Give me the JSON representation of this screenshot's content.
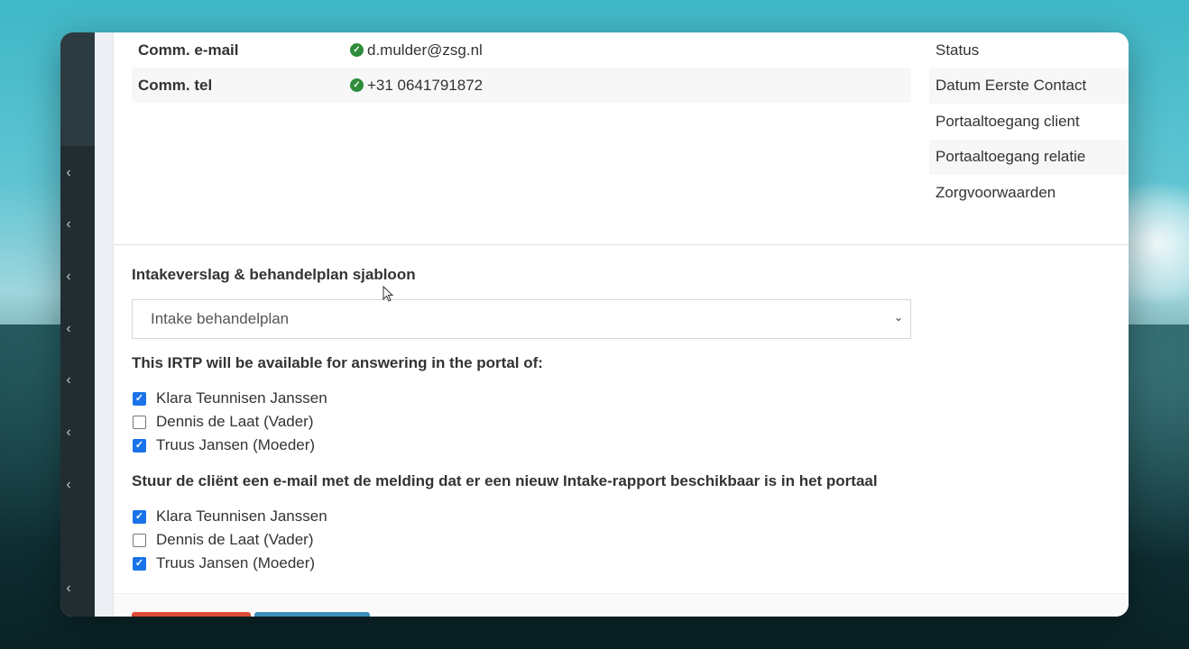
{
  "contact_rows": [
    {
      "label": "Comm. e-mail",
      "value": "d.mulder@zsg.nl"
    },
    {
      "label": "Comm. tel",
      "value": "+31 0641791872"
    }
  ],
  "side_list": [
    "Status",
    "Datum Eerste Contact",
    "Portaaltoegang client",
    "Portaaltoegang relatie",
    "Zorgvoorwaarden"
  ],
  "template": {
    "title": "Intakeverslag & behandelplan sjabloon",
    "selected": "Intake behandelplan"
  },
  "portal": {
    "title": "This IRTP will be available for answering in the portal of:",
    "people": [
      {
        "name": "Klara Teunnisen Janssen",
        "checked": true
      },
      {
        "name": "Dennis de Laat (Vader)",
        "checked": false
      },
      {
        "name": "Truus Jansen (Moeder)",
        "checked": true
      }
    ]
  },
  "email": {
    "title": "Stuur de cliënt een e-mail met de melding dat er een nieuw Intake-rapport beschikbaar is in het portaal",
    "people": [
      {
        "name": "Klara Teunnisen Janssen",
        "checked": true
      },
      {
        "name": "Dennis de Laat (Vader)",
        "checked": false
      },
      {
        "name": "Truus Jansen (Moeder)",
        "checked": true
      }
    ]
  },
  "icons": {
    "verified": "check-circle-icon",
    "sidebar": "chevron-left-icon",
    "select": "chevron-down-icon"
  },
  "colors": {
    "verified": "#2e8b3a",
    "checkbox": "#1a73e8",
    "danger_button": "#dd4b39",
    "primary_button": "#3c8dbc"
  }
}
